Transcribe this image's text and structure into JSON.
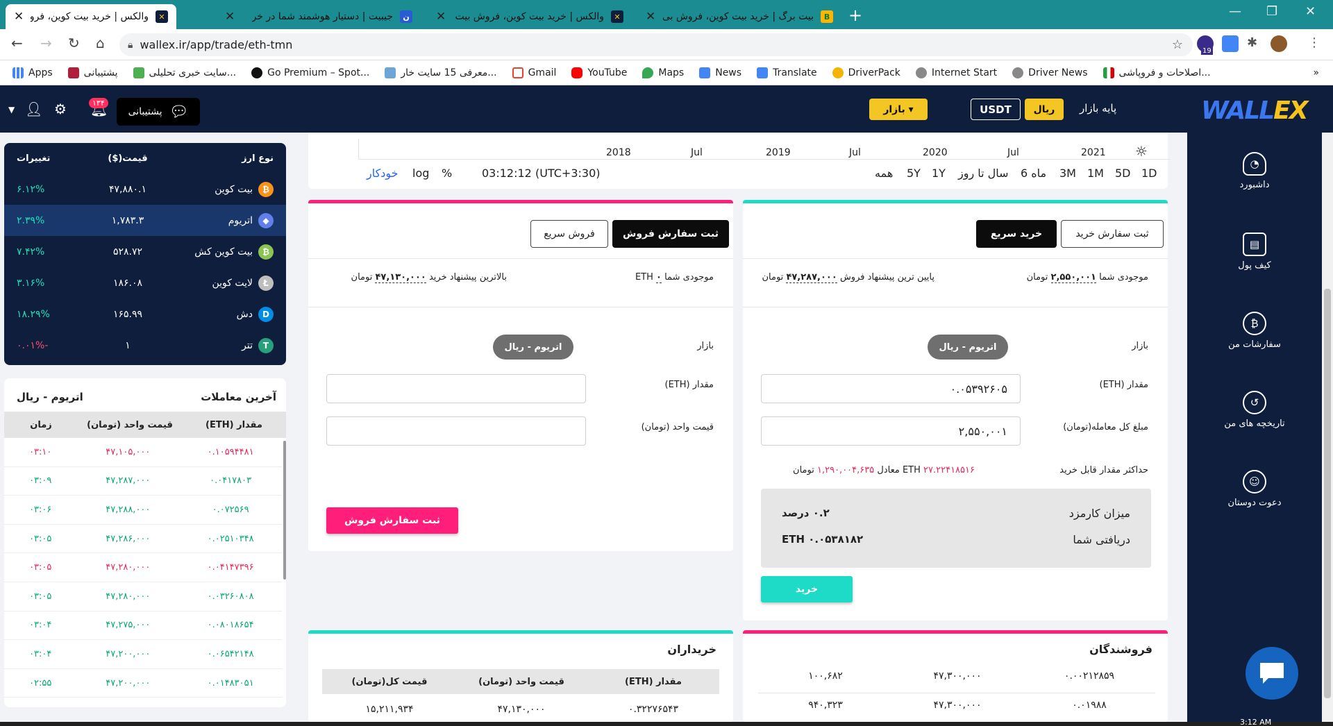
{
  "browser": {
    "tabs": [
      {
        "title": "والکس | خرید بیت کوین، فروش بیت",
        "active": true
      },
      {
        "title": "جیبیت | دستیار هوشمند شما در خر",
        "active": false
      },
      {
        "title": "والکس | خرید بیت کوین، فروش بیت",
        "active": false
      },
      {
        "title": "بیت برگ | خرید بیت کوین، فروش بی",
        "active": false
      }
    ],
    "url": "wallex.ir/app/trade/eth-tmn",
    "ext_badge": "19",
    "bookmarks": [
      "Apps",
      "پشتیبانی",
      "سایت خبری تحلیلی...",
      "Go Premium – Spot...",
      "معرفی 15 سایت خار...",
      "Gmail",
      "YouTube",
      "Maps",
      "News",
      "Translate",
      "DriverPack",
      "Internet Start",
      "Driver News",
      "اصلاحات و فروپاشی..."
    ],
    "more": "»"
  },
  "header": {
    "logo": "WALL",
    "logo_x": "EX",
    "base_market_label": "پایه بازار",
    "rial_btn": "ریال",
    "usdt_btn": "USDT",
    "market_btn": "بازار ▾",
    "support_label": "پشتیبانی",
    "notif_count": "۱۳۴"
  },
  "sidebar": {
    "items": [
      {
        "label": "داشبورد",
        "icon": "dashboard-icon"
      },
      {
        "label": "کیف پول",
        "icon": "wallet-icon"
      },
      {
        "label": "سفارشات من",
        "icon": "bitcoin-icon"
      },
      {
        "label": "تاریخچه های من",
        "icon": "history-icon"
      },
      {
        "label": "دعوت دوستان",
        "icon": "users-icon"
      }
    ]
  },
  "coins": {
    "headers": {
      "type": "نوع ارز",
      "price": "قیمت($)",
      "change": "تغییرات"
    },
    "rows": [
      {
        "name": "بیت کوین",
        "price": "۴۷,۸۸۰.۱",
        "change": "۶.۱۲%",
        "neg": false,
        "color": "#f7931a",
        "sym": "₿"
      },
      {
        "name": "اتریوم",
        "price": "۱,۷۸۳.۳",
        "change": "۲.۳۹%",
        "neg": false,
        "color": "#627eea",
        "sym": "◆"
      },
      {
        "name": "بیت کوین کش",
        "price": "۵۲۸.۷۲",
        "change": "۷.۴۲%",
        "neg": false,
        "color": "#8dc351",
        "sym": "₿"
      },
      {
        "name": "لایت کوین",
        "price": "۱۸۶.۰۸",
        "change": "۳.۱۶%",
        "neg": false,
        "color": "#bebebe",
        "sym": "Ł"
      },
      {
        "name": "دش",
        "price": "۱۶۵.۹۹",
        "change": "۱۸.۲۹%",
        "neg": false,
        "color": "#008ce7",
        "sym": "D"
      },
      {
        "name": "تتر",
        "price": "۱",
        "change": "-۰.۰۱%",
        "neg": true,
        "color": "#26a17b",
        "sym": "T"
      }
    ]
  },
  "trades": {
    "title": "آخرین معاملات",
    "pair": "اتریوم - ریال",
    "headers": {
      "amount": "مقدار (ETH)",
      "price": "قیمت واحد (تومان)",
      "time": "زمان"
    },
    "rows": [
      {
        "amount": "۰.۱۰۵۹۴۴۸۱",
        "price": "۴۷,۱۰۵,۰۰۰",
        "time": "۰۳:۱۰",
        "side": "sell"
      },
      {
        "amount": "۰.۰۴۱۷۸۰۳",
        "price": "۴۷,۲۸۷,۰۰۰",
        "time": "۰۳:۰۹",
        "side": "buy"
      },
      {
        "amount": "۰.۰۷۲۵۶۹",
        "price": "۴۷,۲۸۸,۰۰۰",
        "time": "۰۳:۰۶",
        "side": "buy"
      },
      {
        "amount": "۰.۰۲۵۱۰۳۴۸",
        "price": "۴۷,۲۸۶,۰۰۰",
        "time": "۰۳:۰۵",
        "side": "buy"
      },
      {
        "amount": "۰.۰۴۱۴۷۳۹۶",
        "price": "۴۷,۲۸۰,۰۰۰",
        "time": "۰۳:۰۵",
        "side": "sell"
      },
      {
        "amount": "۰.۰۳۲۶۰۸۰۸",
        "price": "۴۷,۲۸۰,۰۰۰",
        "time": "۰۳:۰۵",
        "side": "buy"
      },
      {
        "amount": "۰.۰۸۰۱۸۶۵۴",
        "price": "۴۷,۲۷۵,۰۰۰",
        "time": "۰۳:۰۴",
        "side": "buy"
      },
      {
        "amount": "۰.۰۶۵۴۲۱۴۸",
        "price": "۴۷,۲۰۰,۰۰۰",
        "time": "۰۳:۰۴",
        "side": "buy"
      },
      {
        "amount": "۰.۰۱۴۸۳۰۵۱",
        "price": "۴۷,۲۰۰,۰۰۰",
        "time": "۰۲:۵۵",
        "side": "buy"
      }
    ]
  },
  "chart": {
    "years": [
      "2018",
      "Jul",
      "2019",
      "Jul",
      "2020",
      "Jul",
      "2021"
    ],
    "timeframes": [
      "1D",
      "5D",
      "1M",
      "3M",
      "6 ماه",
      "سال تا روز",
      "1Y",
      "5Y",
      "همه"
    ],
    "clock": "03:12:12 (UTC+3:30)",
    "percent": "%",
    "log": "log",
    "auto": "خودکار"
  },
  "buy_panel": {
    "tab_order": "ثبت سفارش خرید",
    "tab_quick": "خرید سریع",
    "balance_label": "موجودی شما",
    "balance_value": "۲,۵۵۰,۰۰۱",
    "balance_unit": "تومان",
    "best_label": "پایین ترین پیشنهاد فروش",
    "best_value": "۴۷,۲۸۷,۰۰۰",
    "best_unit": "تومان",
    "market_label": "بازار",
    "market_pill": "اتریوم - ریال",
    "amount_label": "مقدار (ETH)",
    "amount_value": "۰.۰۵۳۹۲۶۰۵",
    "total_label": "مبلغ کل معامله(تومان)",
    "total_value": "۲,۵۵۰,۰۰۱",
    "max_label": "حداکثر مقدار قابل خرید",
    "max_value": "۲۷.۲۲۴۱۸۵۱۶",
    "max_unit": "ETH",
    "equiv_label": "معادل",
    "equiv_value": "۱,۲۹۰,۰۰۴,۶۳۵",
    "equiv_unit": "تومان",
    "fee_label": "میزان کارمزد",
    "fee_value": "۰.۲ درصد",
    "receive_label": "دریافتی شما",
    "receive_value": "ETH ۰.۰۵۳۸۱۸۲",
    "submit": "خرید"
  },
  "sell_panel": {
    "tab_order": "ثبت سفارش فروش",
    "tab_quick": "فروش سریع",
    "balance_label": "موجودی شما",
    "balance_value": "۰",
    "balance_unit": "ETH",
    "best_label": "بالاترین پیشنهاد خرید",
    "best_value": "۴۷,۱۳۰,۰۰۰",
    "best_unit": "تومان",
    "market_label": "بازار",
    "market_pill": "اتریوم - ریال",
    "amount_label": "مقدار (ETH)",
    "price_label": "قیمت واحد (تومان)",
    "submit": "ثبت سفارش فروش"
  },
  "sellers": {
    "title": "فروشندگان",
    "rows": [
      {
        "amount": "۰.۰۰۲۱۲۸۵۹",
        "price": "۴۷,۳۰۰,۰۰۰",
        "total": "۱۰۰,۶۸۲"
      },
      {
        "amount": "۰.۰۱۹۸۸",
        "price": "۴۷,۳۰۰,۰۰۰",
        "total": "۹۴۰,۳۲۳"
      }
    ]
  },
  "buyers": {
    "title": "خریداران",
    "headers": {
      "amount": "مقدار (ETH)",
      "price": "قیمت واحد (تومان)",
      "total": "قیمت کل(تومان)"
    },
    "rows": [
      {
        "amount": "۰.۳۲۲۷۶۵۴۳",
        "price": "۴۷,۱۳۰,۰۰۰",
        "total": "۱۵,۲۱۱,۹۳۴"
      }
    ]
  },
  "taskbar": {
    "time": "3:12 AM"
  },
  "colors": {
    "navy": "#0f1e3d",
    "teal": "#1ddbc6",
    "pink": "#ff1f7a",
    "yellow": "#f3c623"
  }
}
